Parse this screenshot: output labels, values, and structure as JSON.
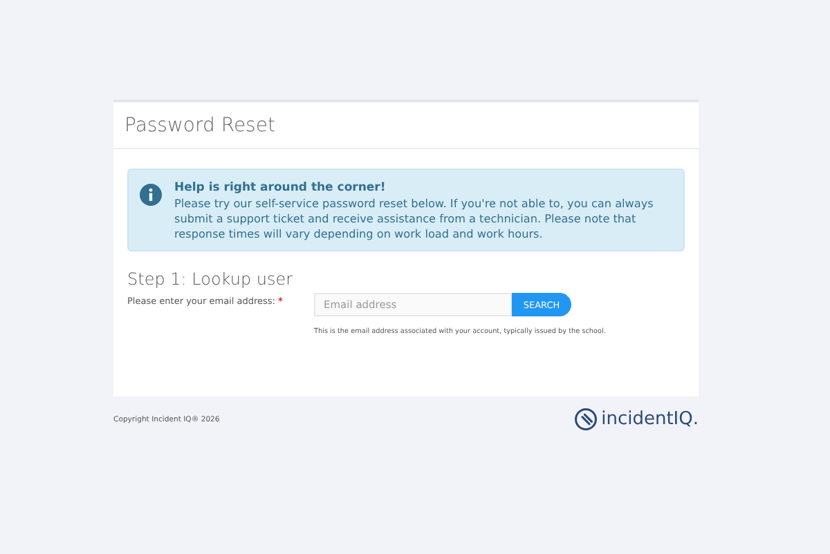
{
  "card": {
    "title": "Password Reset"
  },
  "alert": {
    "heading": "Help is right around the corner!",
    "body": "Please try our self-service password reset below. If you're not able to, you can always submit a support ticket and receive assistance from a technician. Please note that response times will vary depending on work load and work hours."
  },
  "step": {
    "title": "Step 1: Lookup user",
    "label": "Please enter your email address:",
    "required_mark": "*",
    "email_field": {
      "placeholder": "Email address"
    },
    "button": "SEARCH",
    "hint": "This is the email address associated with your account, typically issued by the school."
  },
  "footer": {
    "copyright": "Copyright Incident IQ® 2026",
    "logo_text": "incidentIQ."
  }
}
